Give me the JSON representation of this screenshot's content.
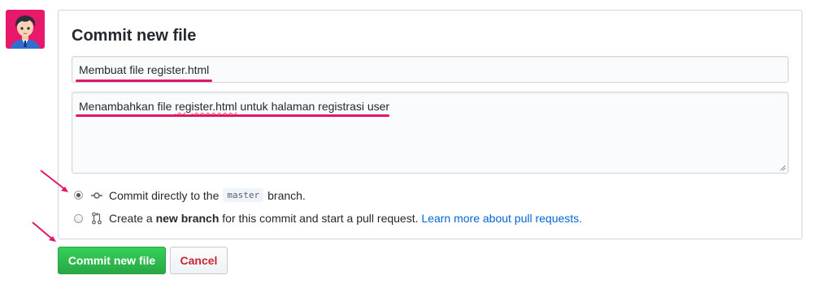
{
  "commit": {
    "title": "Commit new file",
    "summary_value": "Membuat file register.html",
    "description": {
      "before": "Menambahkan file ",
      "misspelled": "register.html",
      "after": " untuk halaman registrasi user"
    },
    "option_direct": {
      "text_before": "Commit directly to the",
      "branch": "master",
      "text_after": "branch.",
      "selected": true
    },
    "option_new_branch": {
      "text_before": "Create a",
      "bold": "new branch",
      "text_after": "for this commit and start a pull request.",
      "link": "Learn more about pull requests.",
      "selected": false
    },
    "commit_button": "Commit new file",
    "cancel_button": "Cancel"
  },
  "icons": {
    "direct": "git-commit-icon",
    "new_branch": "git-pull-request-icon"
  },
  "colors": {
    "accent_highlight": "#e0166b",
    "commit_button": "#2cbe4e",
    "cancel_text": "#cb2431",
    "link": "#0366d6"
  }
}
